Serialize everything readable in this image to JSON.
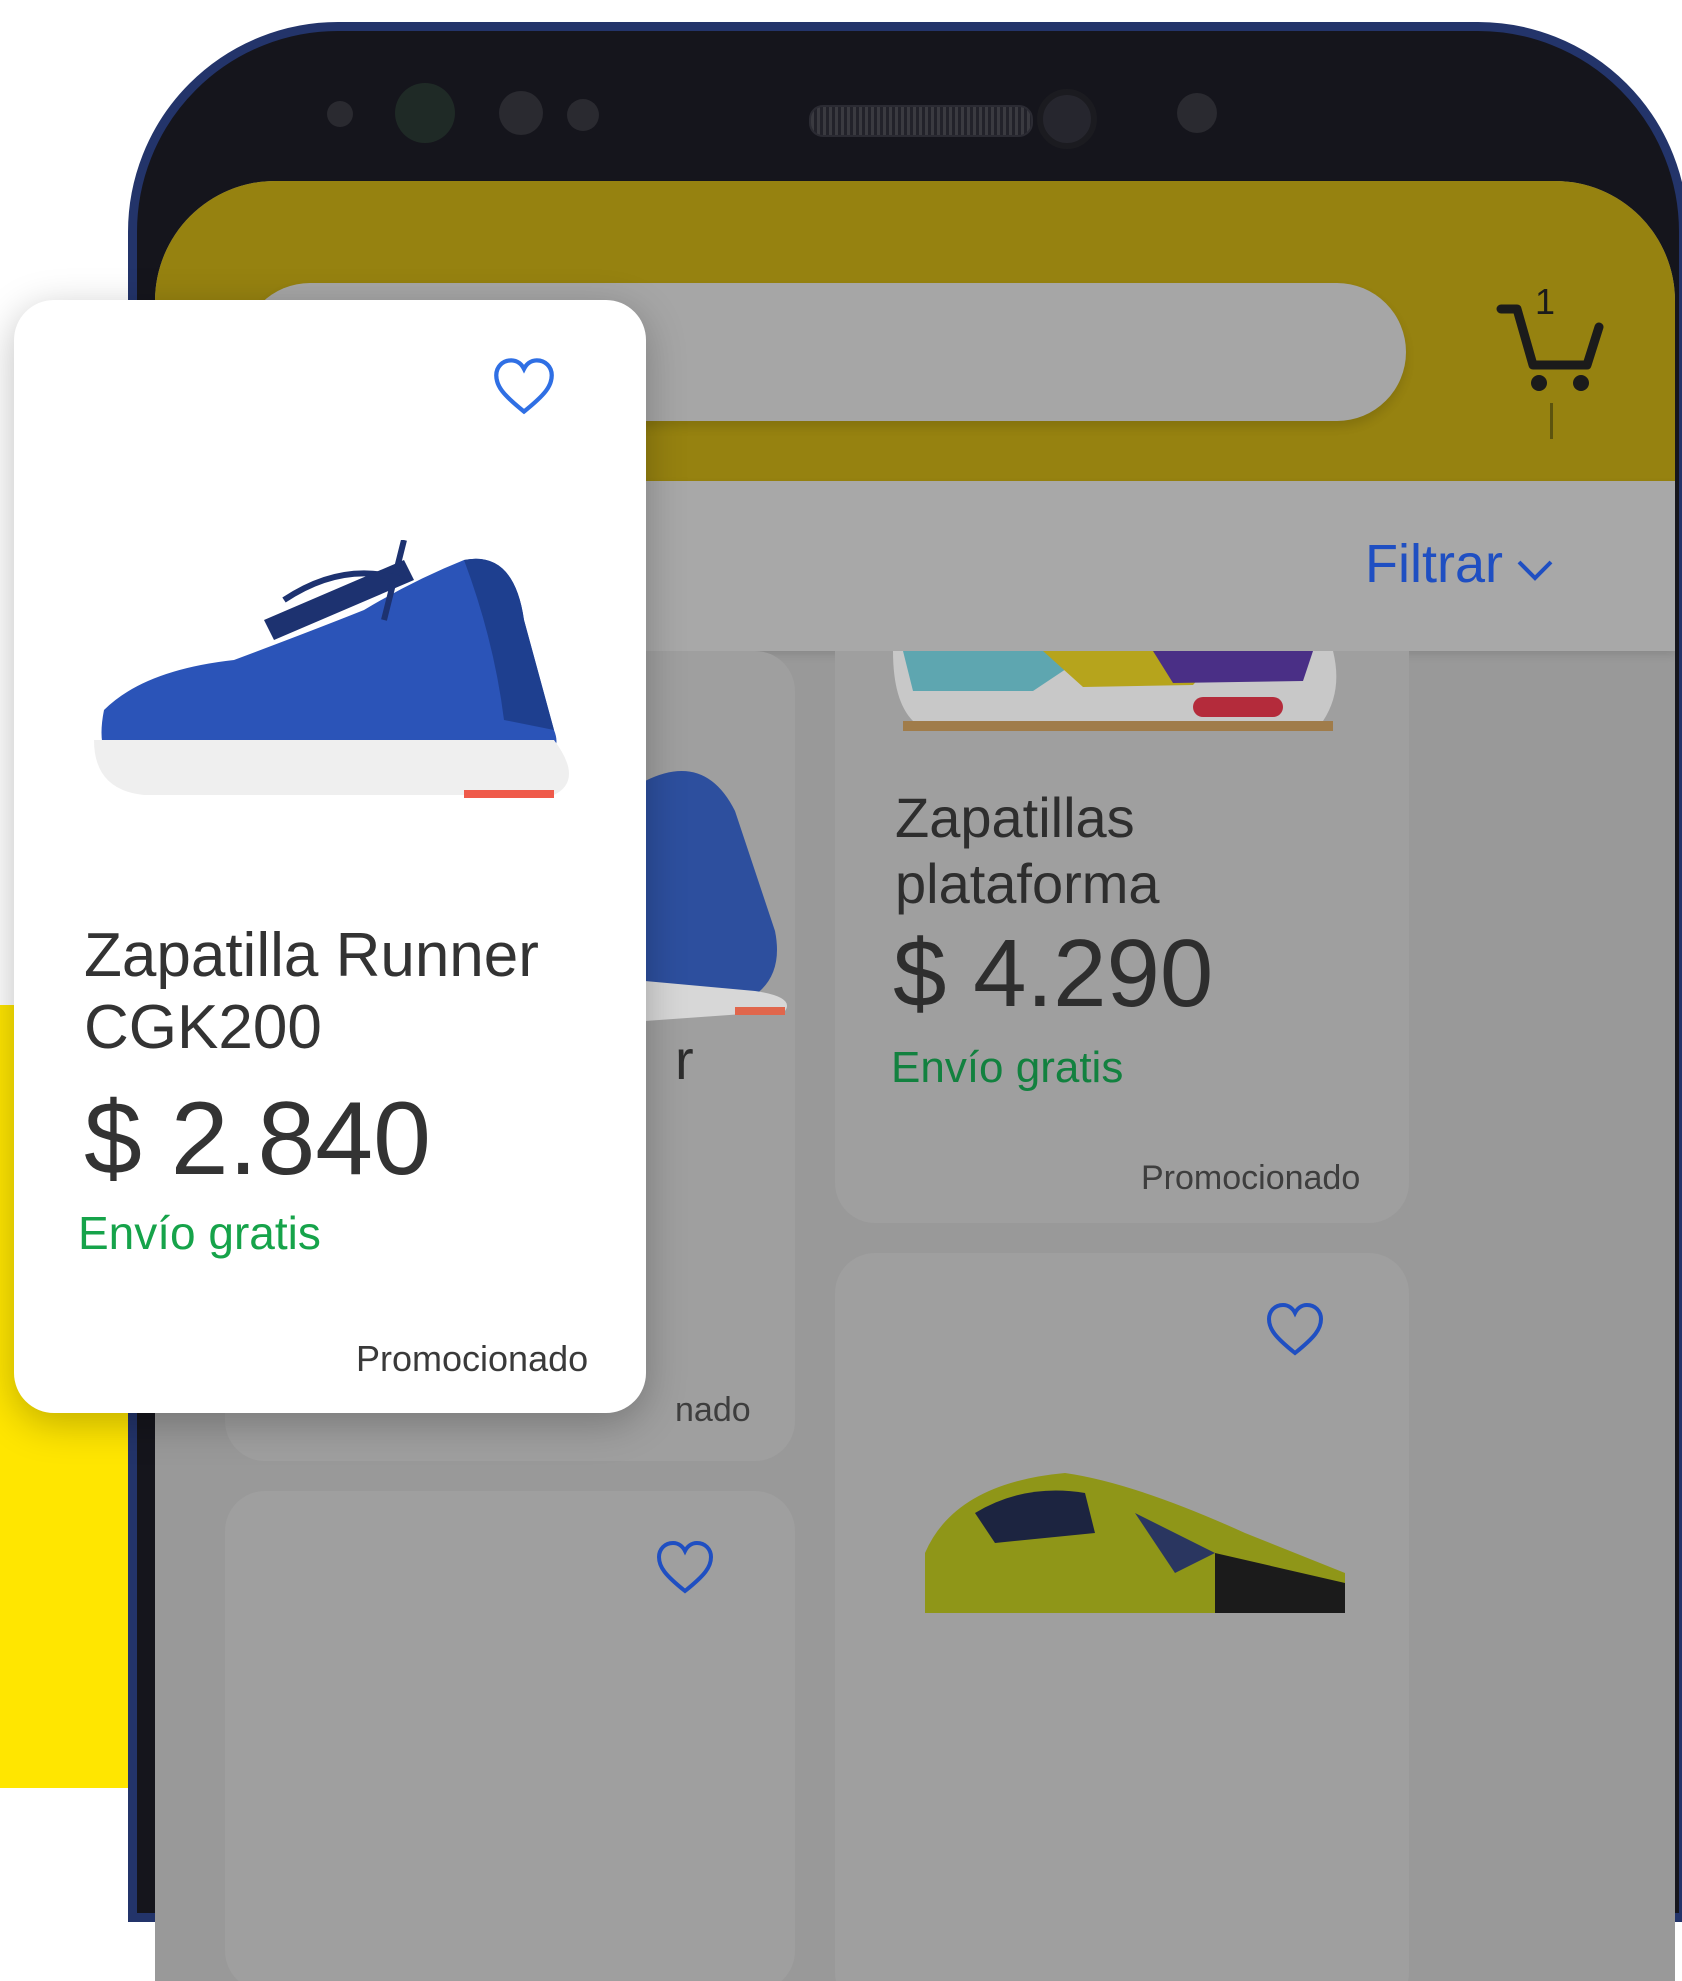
{
  "search": {
    "placeholder": ""
  },
  "cart": {
    "count": "1"
  },
  "filter": {
    "label": "Filtrar"
  },
  "background_cards": [
    {
      "title": "Zapatillas\nplataforma",
      "price": "$ 4.290",
      "shipping": "Envío gratis",
      "badge": "Promocionado"
    },
    {
      "partial_text_1": "r",
      "partial_text_2": "nado"
    }
  ],
  "front_card": {
    "title_line1": "Zapatilla Runner",
    "title_line2": "CGK200",
    "price": "$ 2.840",
    "shipping": "Envío gratis",
    "badge": "Promocionado"
  },
  "colors": {
    "brand_yellow": "#ffe600",
    "header_dim": "#968210",
    "link_blue": "#1f4fc2",
    "ship_green": "#16a34a"
  }
}
